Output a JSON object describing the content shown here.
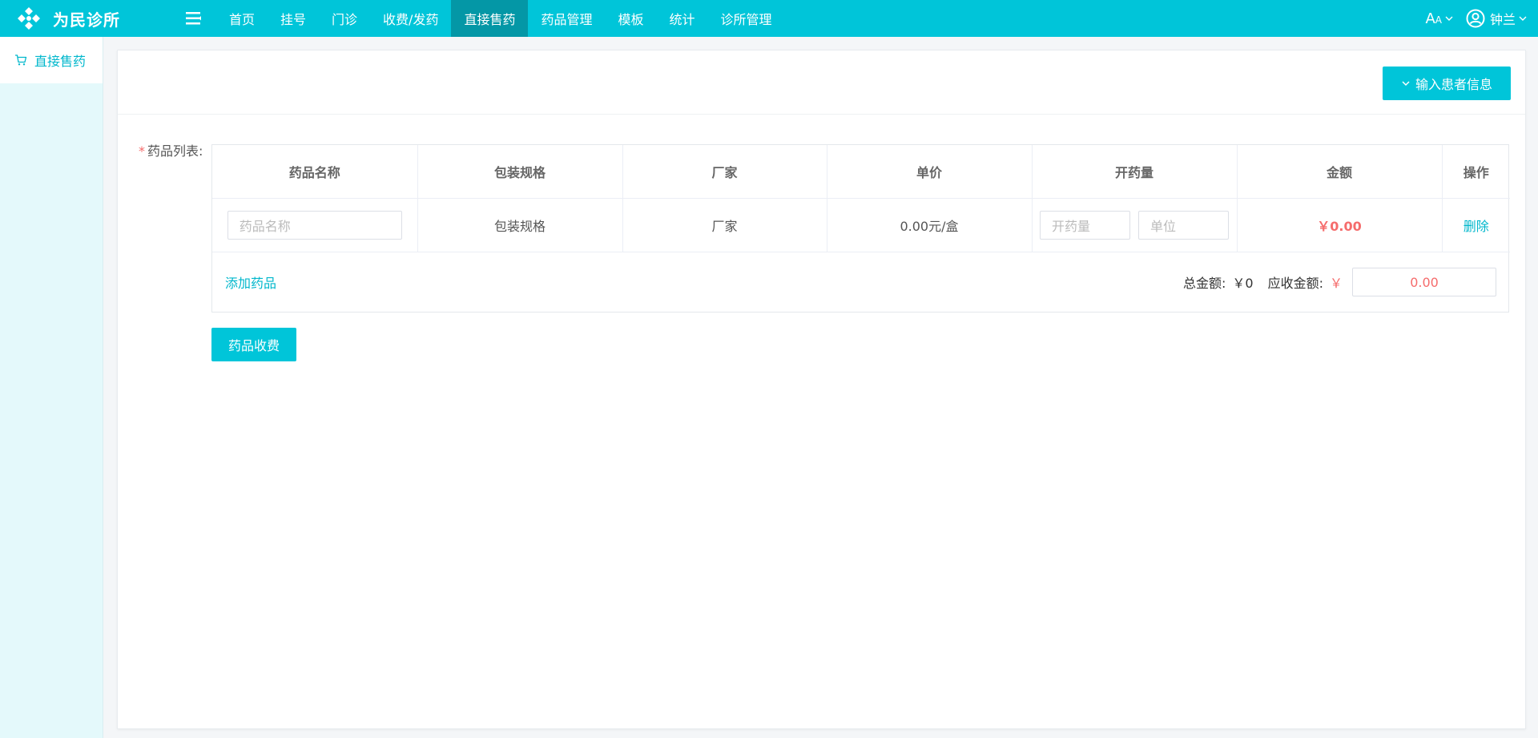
{
  "app": {
    "title": "为民诊所"
  },
  "nav": {
    "items": [
      {
        "label": "首页"
      },
      {
        "label": "挂号"
      },
      {
        "label": "门诊"
      },
      {
        "label": "收费/发药"
      },
      {
        "label": "直接售药"
      },
      {
        "label": "药品管理"
      },
      {
        "label": "模板"
      },
      {
        "label": "统计"
      },
      {
        "label": "诊所管理"
      }
    ],
    "active": "直接售药"
  },
  "header": {
    "font_switch_label": "A",
    "font_switch_small": "A",
    "user_name": "钟兰"
  },
  "sidebar": {
    "items": [
      {
        "label": "直接售药",
        "icon": "cart-icon"
      }
    ]
  },
  "panel": {
    "patient_button_label": "输入患者信息"
  },
  "form": {
    "required_mark": "*",
    "list_label": "药品列表:",
    "table": {
      "columns": [
        "药品名称",
        "包装规格",
        "厂家",
        "单价",
        "开药量",
        "金额",
        "操作"
      ],
      "rows": [
        {
          "name_placeholder": "药品名称",
          "spec": "包装规格",
          "maker": "厂家",
          "unit_price": "0.00元/盒",
          "qty_placeholder": "开药量",
          "unit_placeholder": "单位",
          "amount": "￥0.00",
          "action": "删除"
        }
      ]
    },
    "add_label": "添加药品",
    "total_label": "总金额:",
    "total_value": "￥0",
    "receivable_label": "应收金额:",
    "receivable_currency": "￥",
    "receivable_value": "0.00",
    "charge_button_label": "药品收费"
  },
  "colors": {
    "primary": "#00c5d9",
    "nav_active": "#0497a6",
    "danger": "#f56c6c",
    "sidebar_bg": "#e4f9fb"
  }
}
